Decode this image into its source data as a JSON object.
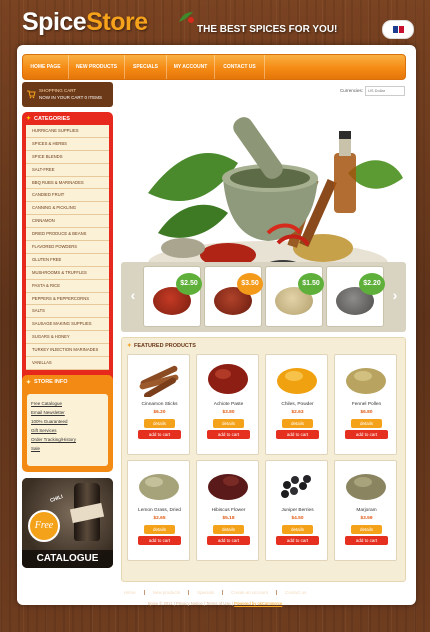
{
  "header": {
    "logo_part1": "Spice",
    "logo_part2": "Store",
    "tagline": "THE BEST SPICES FOR YOU!",
    "language_icon": "uk-flag-icon"
  },
  "nav": {
    "items": [
      "HOME PAGE",
      "NEW PRODUCTS",
      "SPECIALS",
      "MY ACCOUNT",
      "CONTACT US"
    ]
  },
  "cart": {
    "title": "SHOPPING CART",
    "text": "NOW IN YOUR CART 0 ITEMS",
    "icon": "cart-icon"
  },
  "currency": {
    "label": "Currencies:",
    "value": "US Dollar"
  },
  "categories": {
    "title": "CATEGORIES",
    "items": [
      "HURRICANE SUPPLIES",
      "SPICES & HERBS",
      "SPICE BLENDS",
      "SALT-FREE",
      "BBQ RUBS & MARINADES",
      "CANDIED FRUIT",
      "CANNING & PICKLING",
      "CINNAMON",
      "DRIED PRODUCE & BEANS",
      "FLAVORED POWDERS",
      "GLUTEN FREE",
      "MUSHROOMS & TRUFFLES",
      "PASTA & RICE",
      "PEPPERS & PEPPERCORNS",
      "SALTS",
      "SAUSAGE MAKING SUPPLIES",
      "SUGARS & HONEY",
      "TURKEY INJECTION MARINADES",
      "VANILLAS"
    ]
  },
  "store_info": {
    "title": "STORE INFO",
    "items": [
      "Free Catalogue",
      "Email Newsletter",
      "100% Guaranteed",
      "Gift Services",
      "Order Tracking/History",
      "Sale"
    ]
  },
  "catalogue": {
    "free": "Free",
    "caption": "CATALOGUE",
    "chili": "CHILI"
  },
  "slider": {
    "items": [
      {
        "price": "$2.50",
        "color": "#a52a1a"
      },
      {
        "price": "$3.50",
        "color": "#8c2c18"
      },
      {
        "price": "$1.50",
        "color": "#c9b68a"
      },
      {
        "price": "$2.20",
        "color": "#6e6c6a"
      }
    ],
    "prev_icon": "chevron-left-icon",
    "next_icon": "chevron-right-icon"
  },
  "featured": {
    "title": "FEATURED PRODUCTS",
    "details_label": "details",
    "cart_label": "add to cart",
    "products": [
      {
        "name": "Cinnamon Sticks",
        "price": "$6.20",
        "color": "#8a4a22"
      },
      {
        "name": "Achiote Paste",
        "price": "$3.80",
        "color": "#8c1e14"
      },
      {
        "name": "Chiles, Powder",
        "price": "$2.63",
        "color": "#f0a10f"
      },
      {
        "name": "Fennel Pollen",
        "price": "$6.80",
        "color": "#b8a460"
      },
      {
        "name": "Lemon Grass, Dried",
        "price": "$2.65",
        "color": "#a6a37a"
      },
      {
        "name": "Hibiscus Flower",
        "price": "$5.18",
        "color": "#5a1a1a"
      },
      {
        "name": "Juniper Berries",
        "price": "$4.50",
        "color": "#1c1c1e"
      },
      {
        "name": "Marjoram",
        "price": "$3.59",
        "color": "#8a8560"
      }
    ]
  },
  "footer": {
    "links": [
      "Home",
      "New products",
      "Specials",
      "Create an account",
      "Contact us"
    ],
    "copyright": "Spice © 2011",
    "privacy": "Privacy Notice",
    "terms": "Terms of Use",
    "powered": "Powered by osCommerce"
  }
}
